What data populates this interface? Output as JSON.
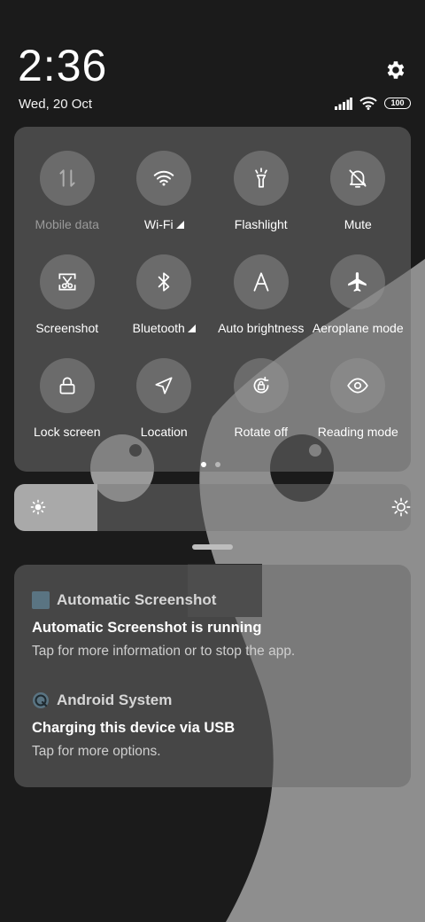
{
  "header": {
    "time": "2:36",
    "date": "Wed, 20 Oct",
    "battery_level": "100"
  },
  "icons": {
    "settings": "gear-icon",
    "signal": "signal-icon",
    "wifi": "wifi-icon",
    "battery": "battery-icon"
  },
  "tiles": [
    {
      "label": "Mobile data",
      "icon": "mobile-data-icon",
      "state": "disabled"
    },
    {
      "label": "Wi-Fi",
      "icon": "wifi-icon",
      "state": "off",
      "expandable": true
    },
    {
      "label": "Flashlight",
      "icon": "flashlight-icon",
      "state": "off"
    },
    {
      "label": "Mute",
      "icon": "mute-icon",
      "state": "off"
    },
    {
      "label": "Screenshot",
      "icon": "screenshot-icon",
      "state": "off"
    },
    {
      "label": "Bluetooth",
      "icon": "bluetooth-icon",
      "state": "off",
      "expandable": true
    },
    {
      "label": "Auto brightness",
      "icon": "auto-brightness-icon",
      "state": "off"
    },
    {
      "label": "Aeroplane mode",
      "icon": "airplane-icon",
      "state": "off"
    },
    {
      "label": "Lock screen",
      "icon": "lock-icon",
      "state": "off"
    },
    {
      "label": "Location",
      "icon": "location-icon",
      "state": "off"
    },
    {
      "label": "Rotate off",
      "icon": "rotate-lock-icon",
      "state": "off"
    },
    {
      "label": "Reading mode",
      "icon": "eye-icon",
      "state": "off"
    }
  ],
  "pagination": {
    "pages": 2,
    "current": 1
  },
  "brightness": {
    "level": 0.21,
    "low_icon": "brightness-low-icon",
    "high_icon": "brightness-high-icon"
  },
  "notifications": [
    {
      "app": "Automatic Screenshot",
      "title": "Automatic Screenshot is running",
      "text": "Tap for more information or to stop the app."
    },
    {
      "app": "Android System",
      "title": "Charging this device via USB",
      "text": "Tap for more options."
    }
  ],
  "colors": {
    "background": "#1b1b1b",
    "panel": "#6e6e6e",
    "brightness_fill": "#a9a9a9",
    "app_icon_square": "#5a7482"
  }
}
